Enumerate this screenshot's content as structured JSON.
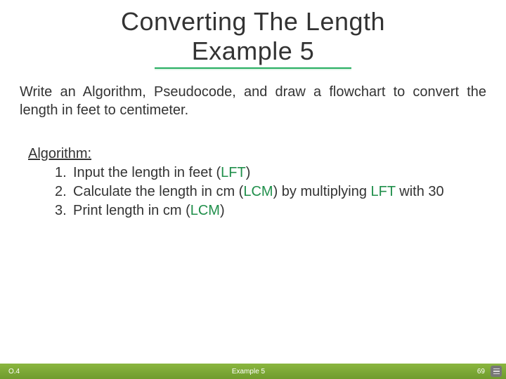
{
  "title": {
    "line1": "Converting The Length",
    "line2": "Example 5"
  },
  "intro": "Write an Algorithm, Pseudocode, and draw a flowchart to convert the length in feet to centimeter.",
  "algorithm": {
    "heading": "Algorithm:",
    "steps": [
      {
        "num": "1.",
        "before": "Input the length in feet (",
        "var": "LFT",
        "after": ")"
      },
      {
        "num": "2.",
        "before": "Calculate the length in cm (",
        "var": "LCM",
        "after": ") by multiplying ",
        "var2": "LFT",
        "after2": " with 30"
      },
      {
        "num": "3.",
        "before": "Print length in cm (",
        "var": "LCM",
        "after": ")"
      }
    ]
  },
  "footer": {
    "left": "O.4",
    "center": "Example 5",
    "right": "69"
  }
}
